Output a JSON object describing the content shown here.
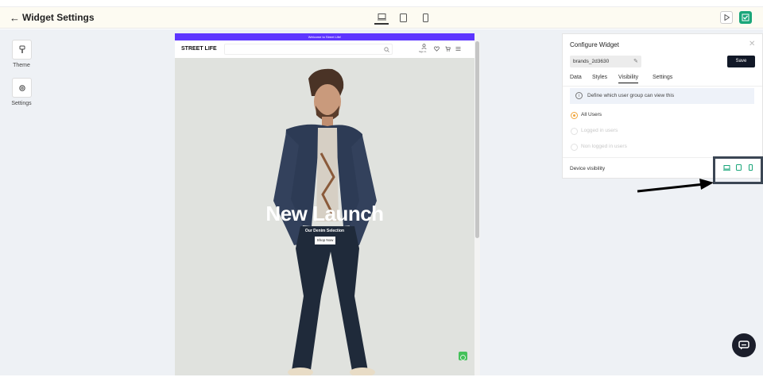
{
  "header": {
    "back_icon": "arrow-left-icon",
    "title": "Widget Settings",
    "device_icons": [
      "desktop-icon",
      "tablet-icon",
      "mobile-icon"
    ],
    "preview_icon": "play-icon",
    "publish_icon": "check-icon"
  },
  "sidebar": {
    "items": [
      {
        "label": "Theme",
        "icon": "brush-icon"
      },
      {
        "label": "Settings",
        "icon": "gear-icon"
      }
    ]
  },
  "preview": {
    "announcement": "Welcome to Street Life!",
    "logo": "STREET LIFE",
    "nav_icons": [
      "search-icon",
      "user-icon",
      "heart-icon",
      "cart-icon",
      "menu-icon"
    ],
    "signin_label": "Sign In",
    "hero_title": "New Launch",
    "hero_subtitle": "Our Denim Selection",
    "hero_button": "Shop Now",
    "whatsapp_icon": "whatsapp-icon"
  },
  "panel": {
    "title": "Configure Widget",
    "widget_id": "brands_2d3630",
    "save_label": "Save",
    "tabs": [
      "Data",
      "Styles",
      "Visibility",
      "Settings"
    ],
    "active_tab": "Visibility",
    "info_text": "Define which user group can view this",
    "options": [
      {
        "label": "All Users",
        "selected": true,
        "enabled": true
      },
      {
        "label": "Logged in users",
        "selected": false,
        "enabled": false
      },
      {
        "label": "Non logged in users",
        "selected": false,
        "enabled": false
      }
    ],
    "device_visibility_label": "Device visibility",
    "device_visibility_icons": [
      "desktop-icon",
      "tablet-icon",
      "mobile-icon"
    ]
  },
  "colors": {
    "accent": "#1aa67a",
    "save_button": "#111827",
    "announcement_bar": "#5d35ff",
    "radio_selected": "#f0a43a"
  }
}
